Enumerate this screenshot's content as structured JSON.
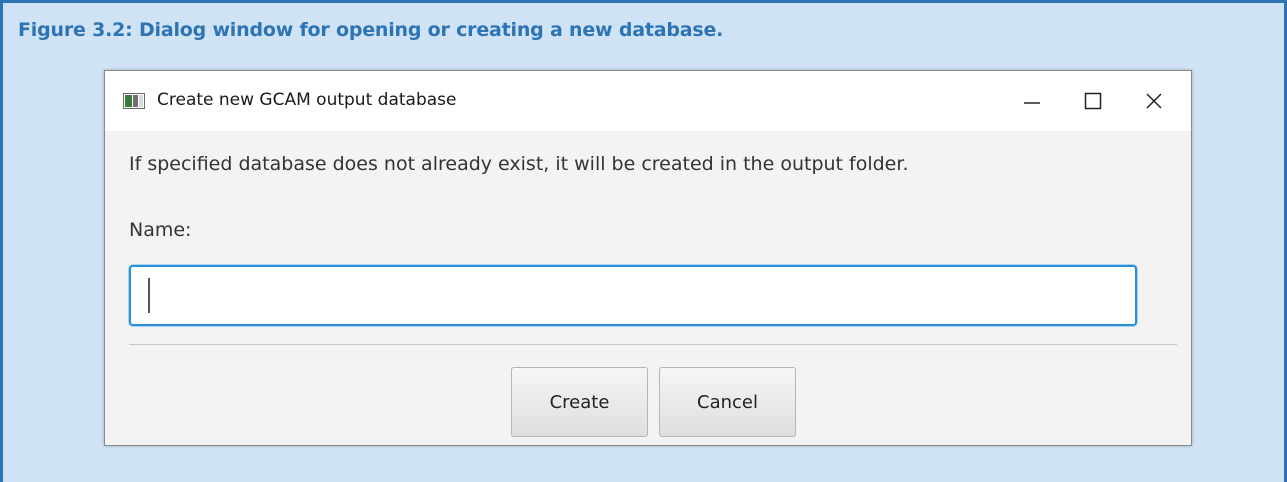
{
  "figure": {
    "caption": "Figure 3.2: Dialog window for opening or creating a new database."
  },
  "dialog": {
    "title": "Create new GCAM output database",
    "icon": "app-window-icon",
    "controls": {
      "minimize_icon": "minimize-icon",
      "maximize_icon": "maximize-icon",
      "close_icon": "close-icon"
    },
    "info_text": "If specified database does not already exist, it will be created in the output folder.",
    "name_label": "Name:",
    "name_input": {
      "value": "",
      "placeholder": ""
    },
    "buttons": {
      "create": "Create",
      "cancel": "Cancel"
    }
  },
  "colors": {
    "figure_background": "#cfe3f5",
    "figure_border": "#2e74b5",
    "caption": "#2e74b5",
    "input_focus": "#2a90d6"
  }
}
